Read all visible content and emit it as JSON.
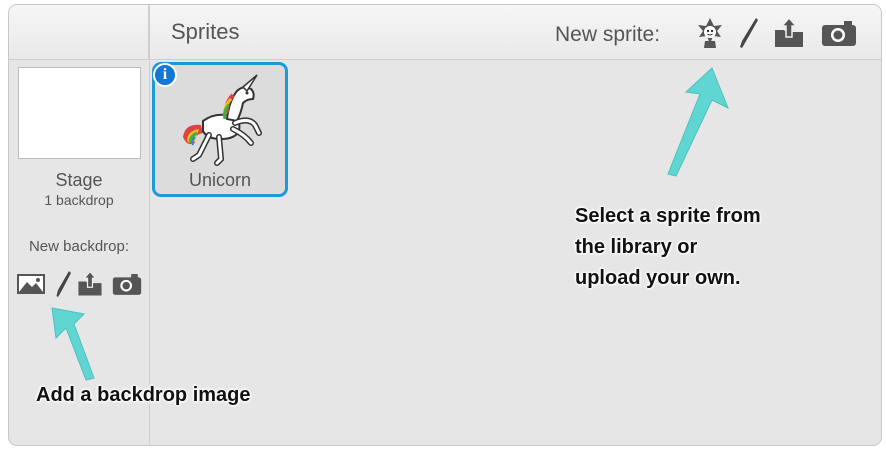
{
  "header": {
    "sprites_title": "Sprites",
    "new_sprite_label": "New sprite:"
  },
  "stage": {
    "name": "Stage",
    "backdrop_count": "1 backdrop",
    "new_backdrop_label": "New backdrop:"
  },
  "sprites": [
    {
      "name": "Unicorn",
      "info_badge": "i"
    }
  ],
  "annotations": {
    "sprite_hint": [
      "Select a sprite from",
      "the library or",
      "upload your own."
    ],
    "backdrop_hint": "Add a backdrop image"
  },
  "icons": {
    "new_sprite": [
      "sprite-library-icon",
      "paint-brush-icon",
      "upload-icon",
      "camera-icon"
    ],
    "new_backdrop": [
      "landscape-image-icon",
      "paint-brush-icon",
      "upload-icon",
      "camera-icon"
    ]
  },
  "colors": {
    "selection_border": "#1b9ad6",
    "info_badge": "#1277d6",
    "arrow": "#5fd6d2"
  }
}
